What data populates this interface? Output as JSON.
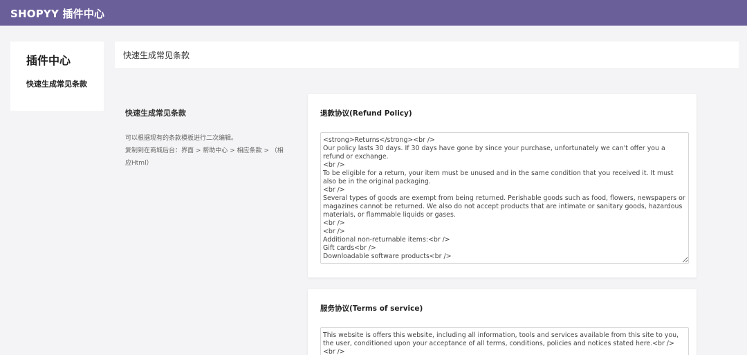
{
  "header": {
    "brand": "SHOPYY 插件中心"
  },
  "sidebar": {
    "title": "插件中心",
    "items": [
      {
        "label": "快速生成常见条款"
      }
    ]
  },
  "page": {
    "title": "快速生成常见条款"
  },
  "info": {
    "title": "快速生成常见条款",
    "lines": [
      "可以根据现有的条款模板进行二次编辑。",
      "复制到在商城后台：界面 > 帮助中心 > 相应条款 > （相",
      "应Html）"
    ]
  },
  "cards": [
    {
      "title": "退款协议(Refund Policy)",
      "content": "<strong>Returns</strong><br />\nOur policy lasts 30 days. If 30 days have gone by since your purchase, unfortunately we can't offer you a refund or exchange.\n<br />\nTo be eligible for a return, your item must be unused and in the same condition that you received it. It must also be in the original packaging.\n<br />\nSeveral types of goods are exempt from being returned. Perishable goods such as food, flowers, newspapers or magazines cannot be returned. We also do not accept products that are intimate or sanitary goods, hazardous materials, or flammable liquids or gases.\n<br />\n<br />\nAdditional non-returnable items:<br />\nGift cards<br />\nDownloadable software products<br />"
    },
    {
      "title": "服务协议(Terms of service)",
      "content": "This website is offers this website, including all information, tools and services available from this site to you, the user, conditioned upon your acceptance of all terms, conditions, policies and notices stated here.<br /><br />"
    }
  ]
}
